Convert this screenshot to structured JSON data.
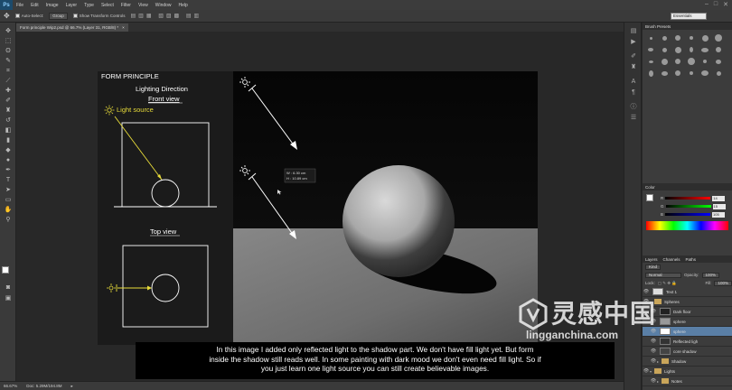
{
  "app": {
    "logo": "Ps",
    "menu": [
      "File",
      "Edit",
      "Image",
      "Layer",
      "Type",
      "Select",
      "Filter",
      "View",
      "Window",
      "Help"
    ],
    "window_controls": [
      "–",
      "□",
      "✕"
    ]
  },
  "options_bar": {
    "auto_select_label": "Auto-Select:",
    "auto_select_value": "Group",
    "show_transform_label": "Show Transform Controls",
    "workspace": "Essentials"
  },
  "document_tab": {
    "title": "Form principle Wip2.psd @ 66.7% (Layer 31, RGB/8) *",
    "close": "×"
  },
  "artboard": {
    "title": "FORM PRINCIPLE",
    "subtitle": "Lighting Direction",
    "front_view": "Front view",
    "light_source": "Light source",
    "top_view": "Top view",
    "measure_w": "W :  6.30 cm",
    "measure_h": "H :  10.89 cm",
    "colors": {
      "light": "#e8dc3a",
      "line": "#ffffff",
      "panel_bg": "#1b1b1b"
    }
  },
  "status_bar": {
    "zoom": "66.67%",
    "doc": "Doc: 5.29M/194.8M"
  },
  "panels": {
    "brush_presets_tab": "Brush Presets",
    "color_tab": "Color",
    "color_values": {
      "r": "14",
      "g": "15",
      "b": "105"
    },
    "layers_tabs": [
      "Layers",
      "Channels",
      "Paths"
    ],
    "kind_label": "Kind",
    "blend_mode": "Normal",
    "opacity_label": "Opacity:",
    "opacity_value": "100%",
    "fill_label": "Fill:",
    "fill_value": "100%",
    "lock_label": "Lock:",
    "layers": [
      {
        "name": "Text 1",
        "type": "layer"
      },
      {
        "name": "Spheres",
        "type": "folder"
      },
      {
        "name": "Dark floor",
        "type": "layer"
      },
      {
        "name": "sphere",
        "type": "layer"
      },
      {
        "name": "sphere",
        "type": "layer"
      },
      {
        "name": "Reflected ligh",
        "type": "layer"
      },
      {
        "name": "core shadow",
        "type": "layer"
      },
      {
        "name": "Shadow",
        "type": "folder"
      },
      {
        "name": "Lights",
        "type": "folder"
      },
      {
        "name": "Notes",
        "type": "folder"
      }
    ]
  },
  "subtitle": {
    "line1": "In this image I added only reflected light to the shadow part. We don't have fill light yet. But form",
    "line2": "inside the shadow still reads well. In some painting with dark mood we don't even need fill light. So if",
    "line3": "you just learn one light source you can still create believable images."
  },
  "watermark": {
    "cn": "灵感中国",
    "url": "lingganchina.com"
  }
}
